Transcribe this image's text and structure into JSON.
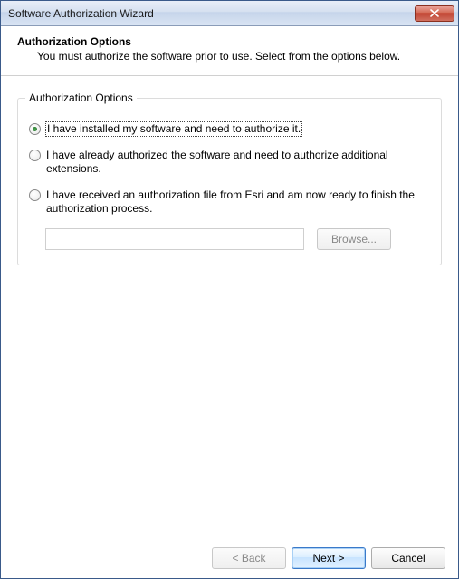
{
  "window": {
    "title": "Software Authorization Wizard"
  },
  "header": {
    "title": "Authorization Options",
    "subtitle": "You must authorize the software prior to use. Select from the options below."
  },
  "group": {
    "title": "Authorization Options",
    "options": [
      {
        "label": "I have installed my software and need to authorize it.",
        "checked": true
      },
      {
        "label": "I have already authorized the software and need to authorize additional extensions.",
        "checked": false
      },
      {
        "label": "I have received an authorization file from Esri and am now ready to finish the authorization process.",
        "checked": false
      }
    ],
    "file_value": "",
    "browse_label": "Browse..."
  },
  "footer": {
    "back": "< Back",
    "next": "Next >",
    "cancel": "Cancel"
  }
}
